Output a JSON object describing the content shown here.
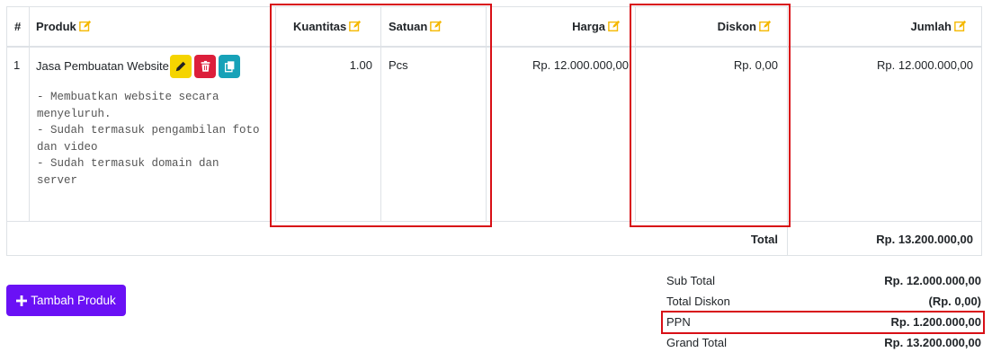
{
  "table": {
    "headers": {
      "no": "#",
      "product": "Produk",
      "qty": "Kuantitas",
      "unit": "Satuan",
      "price": "Harga",
      "discount": "Diskon",
      "amount": "Jumlah"
    },
    "rows": [
      {
        "no": "1",
        "product": "Jasa Pembuatan Website",
        "description": "- Membuatkan website secara\nmenyeluruh.\n- Sudah termasuk pengambilan foto\ndan video\n- Sudah termasuk domain dan\nserver",
        "qty": "1.00",
        "unit": "Pcs",
        "price": "Rp. 12.000.000,00",
        "discount": "Rp. 0,00",
        "amount": "Rp. 12.000.000,00"
      }
    ],
    "total_label": "Total",
    "total_value": "Rp. 13.200.000,00"
  },
  "add_button_label": "Tambah Produk",
  "summary": {
    "subtotal_label": "Sub Total",
    "subtotal_value": "Rp. 12.000.000,00",
    "discount_label": "Total Diskon",
    "discount_value": "(Rp. 0,00)",
    "tax_label": "PPN",
    "tax_value": "Rp. 1.200.000,00",
    "grand_label": "Grand Total",
    "grand_value": "Rp. 13.200.000,00"
  },
  "colors": {
    "edit_icon": "#f5b800",
    "edit_btn": "#f5d400",
    "delete_btn": "#dc1f3b",
    "copy_btn": "#17a2b8",
    "primary": "#6a11f5",
    "highlight": "#d80f16"
  },
  "icons": [
    "edit-icon",
    "pencil-icon",
    "trash-icon",
    "copy-icon",
    "plus-icon"
  ]
}
